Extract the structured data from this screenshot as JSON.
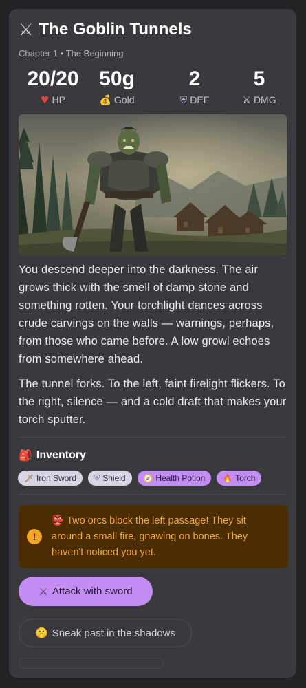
{
  "header": {
    "title": "The Goblin Tunnels",
    "subtitle": "Chapter 1 • The Beginning",
    "title_icon": "crossed-swords-icon"
  },
  "stats": [
    {
      "value": "20/20",
      "label": "HP",
      "icon": "heart-icon"
    },
    {
      "value": "50g",
      "label": "Gold",
      "icon": "money-bag-icon"
    },
    {
      "value": "2",
      "label": "DEF",
      "icon": "shield-icon"
    },
    {
      "value": "5",
      "label": "DMG",
      "icon": "crossed-swords-icon"
    }
  ],
  "story": {
    "paragraphs": [
      "You descend deeper into the darkness. The air grows thick with the smell of damp stone and something rotten. Your torchlight dances across crude carvings on the walls — warnings, perhaps, from those who came before. A low growl echoes from somewhere ahead.",
      "The tunnel forks. To the left, faint firelight flickers. To the right, silence — and a cold draft that makes your torch sputter."
    ]
  },
  "inventory": {
    "title": "Inventory",
    "items": [
      {
        "label": "Iron Sword",
        "icon": "dagger-icon",
        "style": "plain"
      },
      {
        "label": "Shield",
        "icon": "shield-icon",
        "style": "plain"
      },
      {
        "label": "Health Potion",
        "icon": "compass-icon",
        "style": "accent"
      },
      {
        "label": "Torch",
        "icon": "fire-icon",
        "style": "accent"
      }
    ]
  },
  "alert": {
    "text": "Two orcs block the left passage! They sit around a small fire, gnawing on bones. They haven't noticed you yet.",
    "icon": "goblin-icon"
  },
  "actions": {
    "primary": "Attack with sword",
    "secondary": "Sneak past in the shadows"
  },
  "colors": {
    "accent": "#c38df3",
    "warning_bg": "#4a2d00",
    "warning_text": "#f5a83e",
    "card_bg": "#3a3a3e"
  }
}
